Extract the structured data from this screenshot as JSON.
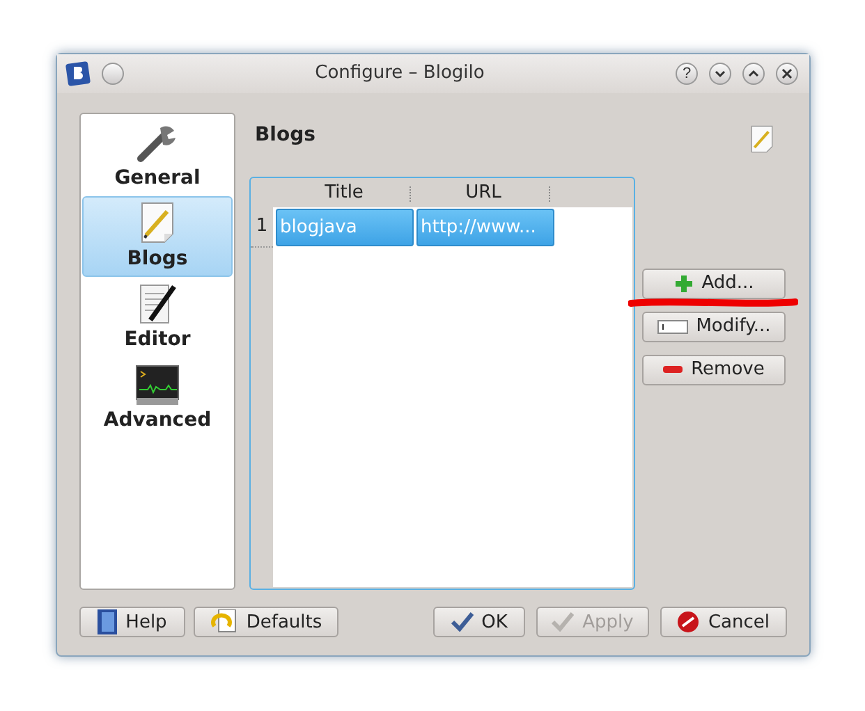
{
  "window": {
    "title": "Configure – Blogilo",
    "help_button": "?"
  },
  "sidebar": {
    "items": [
      {
        "label": "General",
        "selected": false
      },
      {
        "label": "Blogs",
        "selected": true
      },
      {
        "label": "Editor",
        "selected": false
      },
      {
        "label": "Advanced",
        "selected": false
      }
    ]
  },
  "page": {
    "title": "Blogs"
  },
  "table": {
    "columns": [
      "Title",
      "URL"
    ],
    "rows": [
      {
        "number": "1",
        "selected": true,
        "cells": [
          "blogjava",
          "http://www..."
        ]
      }
    ]
  },
  "actions": [
    {
      "label": "Add...",
      "kind": "add",
      "marked": true
    },
    {
      "label": "Modify...",
      "kind": "modify",
      "marked": false
    },
    {
      "label": "Remove",
      "kind": "remove",
      "marked": false
    }
  ],
  "buttons": [
    {
      "label": "Help",
      "kind": "help",
      "disabled": false
    },
    {
      "label": "Defaults",
      "kind": "defaults",
      "disabled": false
    },
    {
      "label": "OK",
      "kind": "ok",
      "disabled": false
    },
    {
      "label": "Apply",
      "kind": "apply",
      "disabled": true
    },
    {
      "label": "Cancel",
      "kind": "cancel",
      "disabled": false
    }
  ]
}
